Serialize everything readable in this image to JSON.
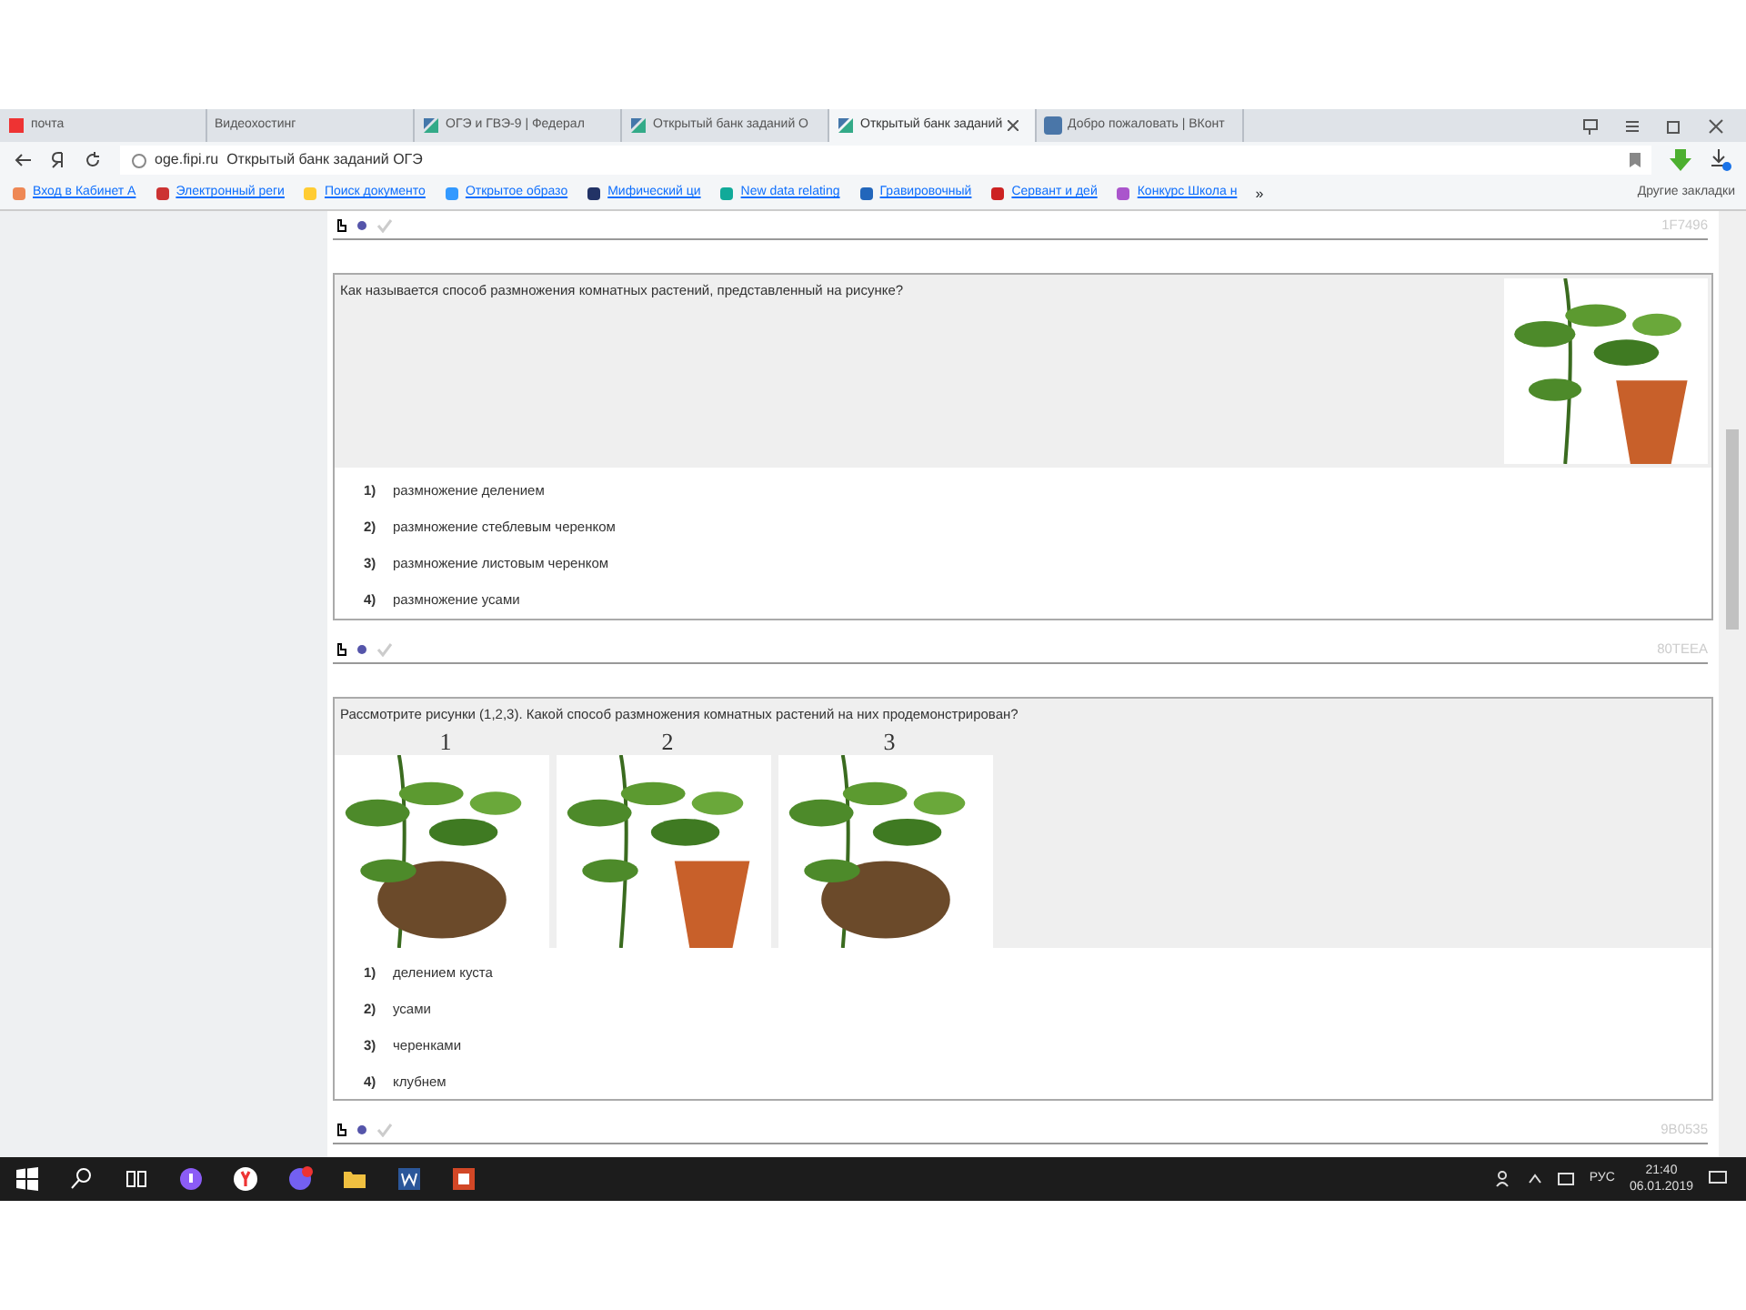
{
  "browser": {
    "tabs": [
      {
        "label": "почта",
        "selected": false,
        "kind": "yandex"
      },
      {
        "label": "Видеохостинг",
        "selected": false,
        "kind": "none"
      },
      {
        "label": "ОГЭ и ГВЭ-9 | Федерал",
        "selected": false,
        "kind": "fipi"
      },
      {
        "label": "Открытый банк заданий О",
        "selected": false,
        "kind": "fipi"
      },
      {
        "label": "Открытый банк заданий",
        "selected": true,
        "kind": "fipi"
      },
      {
        "label": "Добро пожаловать | ВКонт",
        "selected": false,
        "kind": "vk"
      }
    ],
    "address": {
      "url": "oge.fipi.ru",
      "title": "Открытый банк заданий ОГЭ"
    },
    "bookmarks": [
      {
        "label": "Вход в Кабинет А"
      },
      {
        "label": "Электронный реги"
      },
      {
        "label": "Поиск документо"
      },
      {
        "label": "Открытое образо"
      },
      {
        "label": "Мифический ци"
      },
      {
        "label": "New data relating"
      },
      {
        "label": "Гравировочный"
      },
      {
        "label": "Сервант и дей"
      },
      {
        "label": "Конкурс Школа н"
      }
    ],
    "more": "»",
    "other_bookmarks": "Другие закладки"
  },
  "prev_task": {
    "id": "1F7496"
  },
  "tasks": [
    {
      "question": "Как называется способ размножения комнатных растений, представленный на рисунке?",
      "kind": "image_right",
      "options": [
        {
          "number": "1)",
          "text": "размножение делением"
        },
        {
          "number": "2)",
          "text": "размножение стеблевым черенком"
        },
        {
          "number": "3)",
          "text": "размножение листовым черенком"
        },
        {
          "number": "4)",
          "text": "размножение усами"
        }
      ],
      "id": "80TEEA"
    },
    {
      "question": "Рассмотрите рисунки (1,2,3). Какой способ размножения комнатных растений на них продемонстрирован?",
      "kind": "images_below",
      "pictures": [
        {
          "kind": "picture",
          "caption": "1"
        },
        {
          "kind": "picture",
          "caption": "2"
        },
        {
          "kind": "picture",
          "caption": "3"
        }
      ],
      "options": [
        {
          "number": "1)",
          "text": "делением куста"
        },
        {
          "number": "2)",
          "text": "усами"
        },
        {
          "number": "3)",
          "text": "черенками"
        },
        {
          "number": "4)",
          "text": "клубнем"
        }
      ],
      "id": "9B0535"
    }
  ],
  "taskbar": {
    "lang": "РУС",
    "time": "21:40",
    "date": "06.01.2019"
  }
}
